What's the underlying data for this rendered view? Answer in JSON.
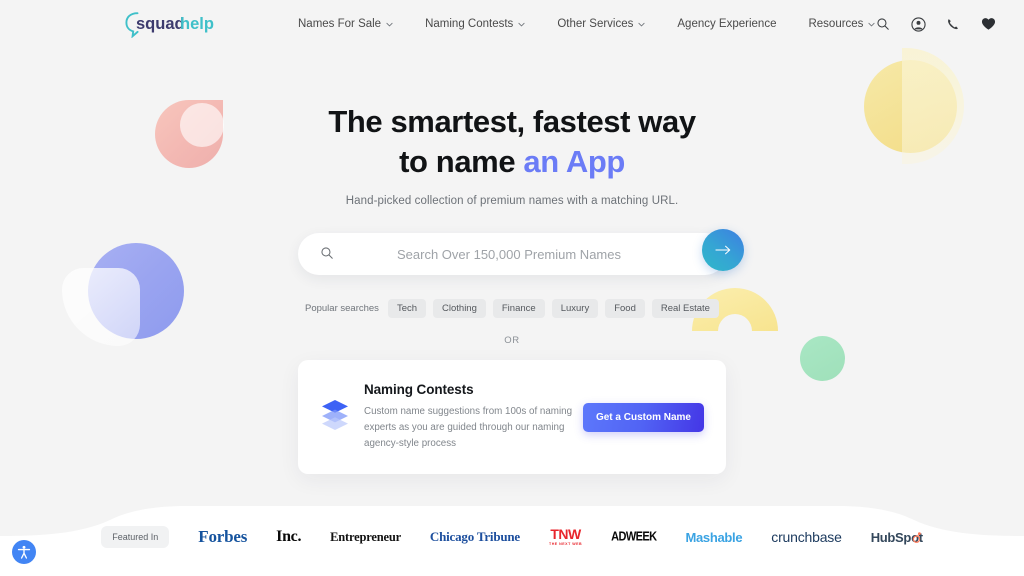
{
  "brand": {
    "name_part1": "squad",
    "name_part2": "help",
    "color_dark": "#3d3b6e",
    "color_teal": "#3fc0c9"
  },
  "nav": {
    "items": [
      {
        "label": "Names For Sale",
        "has_caret": true
      },
      {
        "label": "Naming Contests",
        "has_caret": true
      },
      {
        "label": "Other Services",
        "has_caret": true
      },
      {
        "label": "Agency Experience",
        "has_caret": false
      },
      {
        "label": "Resources",
        "has_caret": true
      }
    ],
    "icons": [
      "search-icon",
      "account-icon",
      "phone-icon",
      "heart-icon"
    ]
  },
  "hero": {
    "headline_line1": "The smartest, fastest way",
    "headline_line2_plain": "to name ",
    "headline_line2_accent": "an App",
    "accent_color": "#6b7cf6",
    "subtitle": "Hand-picked collection of premium names with a matching URL."
  },
  "search": {
    "placeholder": "Search Over 150,000 Premium Names",
    "value": "",
    "submit_icon": "arrow-right-icon"
  },
  "popular": {
    "label": "Popular searches",
    "tags": [
      "Tech",
      "Clothing",
      "Finance",
      "Luxury",
      "Food",
      "Real Estate"
    ]
  },
  "divider": {
    "or": "OR"
  },
  "contest_card": {
    "icon": "layers-icon",
    "title": "Naming Contests",
    "description": "Custom name suggestions from 100s of naming experts as you are guided through our naming agency-style process",
    "button_label": "Get a Custom Name",
    "button_color": "#5163f4"
  },
  "featured": {
    "pill_label": "Featured In",
    "brands": [
      {
        "name": "Forbes",
        "text": "Forbes",
        "color": "#15539e"
      },
      {
        "name": "Inc.",
        "text": "Inc.",
        "color": "#0a0a0a"
      },
      {
        "name": "Entrepreneur",
        "text": "Entrepreneur",
        "color": "#121212"
      },
      {
        "name": "Chicago Tribune",
        "text": "Chicago Tribune",
        "color": "#1d4f9e"
      },
      {
        "name": "TNW",
        "text": "TNW",
        "subtext": "THE NEXT WEB",
        "color": "#e8262d"
      },
      {
        "name": "Adweek",
        "text": "ADWEEK",
        "color": "#0a0a0a"
      },
      {
        "name": "Mashable",
        "text": "Mashable",
        "color": "#3aa3e3"
      },
      {
        "name": "Crunchbase",
        "text": "crunchbase",
        "color": "#1c3a5e"
      },
      {
        "name": "HubSpot",
        "text": "HubSpot",
        "color": "#33475b"
      }
    ]
  },
  "accessibility": {
    "icon": "accessibility-icon",
    "color": "#4285f4"
  },
  "decorations": {
    "pink": "#f3b3ad",
    "purple": "#9aa4f0",
    "yellow": "#f4e193",
    "green": "#9fe0ba"
  }
}
